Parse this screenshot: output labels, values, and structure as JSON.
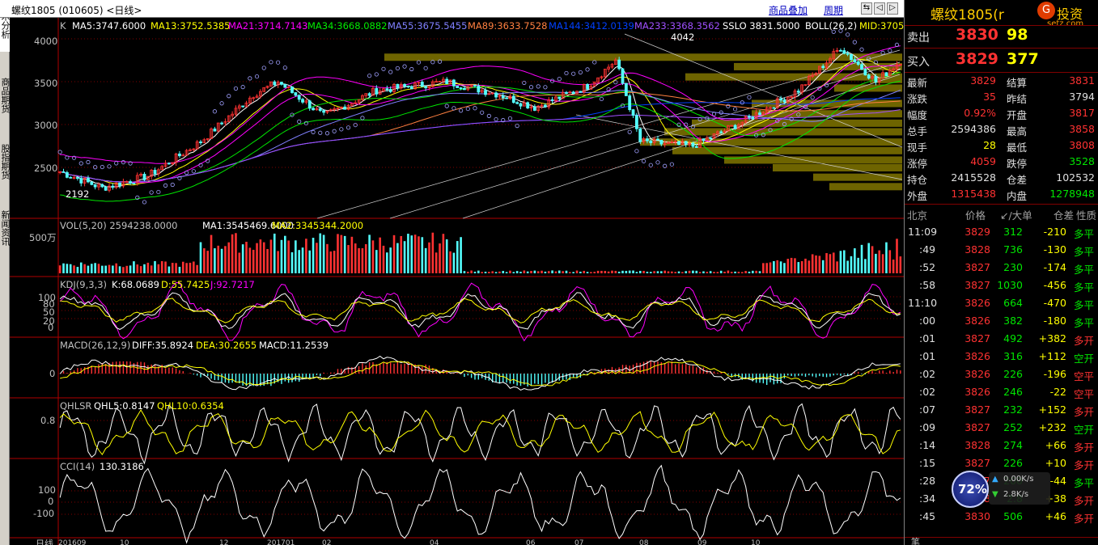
{
  "header": {
    "title": "螺纹1805 (010605) <日线>",
    "link1": "商品叠加",
    "link2": "周期",
    "btn1": "⇆",
    "btn2": "◁",
    "btn3": "▷",
    "btn4": "✕"
  },
  "vtabs": [
    "技术分析",
    "商品期货",
    "股指期货",
    "新闻资讯"
  ],
  "panels": {
    "kline": {
      "l1": "K",
      "l2": "MA5:3747.6000",
      "l3": "MA13:3752.5385",
      "l4": "MA21:3714.7143",
      "l5": "MA34:3668.0882",
      "l6": "MA55:3675.5455",
      "l7": "MA89:3633.7528",
      "l8": "MA144:3412.0139",
      "l9": "MA233:3368.3562",
      "l10": "SSLO  3831.5000",
      "l11": "BOLL(26,2)",
      "l12": "MID:3705",
      "ticks": [
        "4000",
        "3500",
        "3000",
        "2500"
      ],
      "hi": "4042",
      "lo": "2192"
    },
    "vol": {
      "l1": "VOL(5,20)  2594238.0000",
      "l2": "MA1:3545469.6000",
      "l3": "MA2:3345344.2000",
      "tick": "500万"
    },
    "kdj": {
      "l1": "KDJ(9,3,3)",
      "l2": "K:68.0689",
      "l3": "D:55.7425",
      "l4": "J:92.7217",
      "ticks": [
        "100",
        "80",
        "50",
        "20",
        "0"
      ]
    },
    "macd": {
      "l1": "MACD(26,12,9)",
      "l2": "DIFF:35.8924",
      "l3": "DEA:30.2655",
      "l4": "MACD:11.2539",
      "tick": "0"
    },
    "qhlsr": {
      "l1": "QHLSR",
      "l2": "QHL5:0.8147",
      "l3": "QHL10:0.6354",
      "tick": "0.8"
    },
    "cci": {
      "l1": "CCI(14)",
      "l2": "130.3186",
      "ticks": [
        "100",
        "0",
        "-100"
      ]
    }
  },
  "xaxis": {
    "label": "日线",
    "dates": [
      "201609",
      "10",
      "12",
      "201701",
      "02",
      "04",
      "06",
      "07",
      "08",
      "09",
      "10"
    ]
  },
  "right": {
    "title": "螺纹1805(r",
    "brand": "投资",
    "site": "setz.com",
    "sell_label": "卖出",
    "sell_price": "3830",
    "sell_vol": "98",
    "buy_label": "买入",
    "buy_price": "3829",
    "buy_vol": "377",
    "stats": [
      [
        "最新",
        "3829",
        "结算",
        "3831"
      ],
      [
        "涨跌",
        "35",
        "昨结",
        "3794"
      ],
      [
        "幅度",
        "0.92%",
        "开盘",
        "3817"
      ],
      [
        "总手",
        "2594386",
        "最高",
        "3858"
      ],
      [
        "现手",
        "28",
        "最低",
        "3808"
      ],
      [
        "涨停",
        "4059",
        "跌停",
        "3528"
      ],
      [
        "持仓",
        "2415528",
        "仓差",
        "102532"
      ],
      [
        "外盘",
        "1315438",
        "内盘",
        "1278948"
      ]
    ],
    "tick_header": [
      "北京",
      "价格",
      "↙/大单",
      "仓差",
      "性质"
    ],
    "ticks": [
      [
        "11:09",
        "3829",
        "312",
        "-210",
        "多平"
      ],
      [
        ":49",
        "3828",
        "736",
        "-130",
        "多平"
      ],
      [
        ":52",
        "3827",
        "230",
        "-174",
        "多平"
      ],
      [
        ":58",
        "3827",
        "1030",
        "-456",
        "多平"
      ],
      [
        "11:10",
        "3826",
        "664",
        "-470",
        "多平"
      ],
      [
        ":00",
        "3826",
        "382",
        "-180",
        "多平"
      ],
      [
        ":01",
        "3827",
        "492",
        "+382",
        "多开"
      ],
      [
        ":01",
        "3826",
        "316",
        "+112",
        "空开"
      ],
      [
        ":02",
        "3826",
        "226",
        "-196",
        "空平"
      ],
      [
        ":02",
        "3826",
        "246",
        "-22",
        "空平"
      ],
      [
        ":07",
        "3827",
        "232",
        "+152",
        "多开"
      ],
      [
        ":09",
        "3827",
        "252",
        "+232",
        "空开"
      ],
      [
        ":14",
        "3828",
        "274",
        "+66",
        "多开"
      ],
      [
        ":15",
        "3827",
        "226",
        "+10",
        "多开"
      ],
      [
        ":28",
        "3827",
        "200",
        "-44",
        "多平"
      ],
      [
        ":34",
        "3828",
        "2.8",
        "+38",
        "多开"
      ],
      [
        ":45",
        "3830",
        "506",
        "+46",
        "多开"
      ]
    ],
    "gauge_pct": "72%",
    "net_up": "0.00K/s",
    "net_down": "2.8K/s",
    "footer": "笔"
  },
  "colors": {
    "up": "#ff3232",
    "down": "#54ffff",
    "ma5": "#ffffff",
    "ma13": "#ffff00",
    "ma21": "#ff00ff",
    "ma34": "#00e600",
    "ma55": "#8080ff",
    "ma89": "#ff8040",
    "ma144": "#0040ff",
    "ma233": "#a050ff",
    "bg": "#000000",
    "grid": "#800000"
  }
}
